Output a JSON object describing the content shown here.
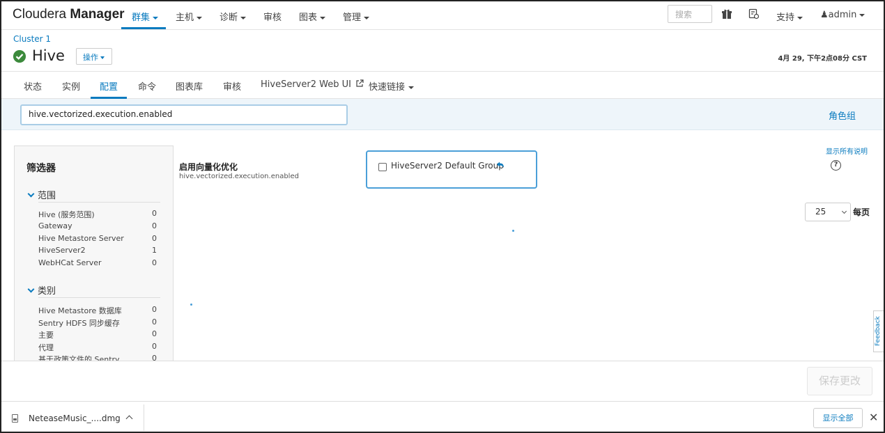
{
  "brand": {
    "name_light": "Cloudera",
    "name_bold": "Manager"
  },
  "topnav": {
    "items": [
      {
        "label": "群集",
        "active": true
      },
      {
        "label": "主机"
      },
      {
        "label": "诊断"
      },
      {
        "label": "审核"
      },
      {
        "label": "图表"
      },
      {
        "label": "管理"
      }
    ],
    "search_placeholder": "搜索",
    "support_label": "支持",
    "user_label": "admin"
  },
  "header": {
    "cluster": "Cluster 1",
    "service": "Hive",
    "actions_label": "操作",
    "timestamp": "4月 29, 下午2点08分 CST"
  },
  "tabs": [
    {
      "label": "状态"
    },
    {
      "label": "实例"
    },
    {
      "label": "配置",
      "active": true
    },
    {
      "label": "命令"
    },
    {
      "label": "图表库"
    },
    {
      "label": "审核"
    },
    {
      "label": "HiveServer2 Web UI"
    },
    {
      "label": "快速链接"
    }
  ],
  "config_search": {
    "value": "hive.vectorized.execution.enabled"
  },
  "role_groups_label": "角色组",
  "filters": {
    "title": "筛选器",
    "scope": {
      "label": "范围",
      "items": [
        {
          "name": "Hive (服务范围)",
          "count": "0"
        },
        {
          "name": "Gateway",
          "count": "0"
        },
        {
          "name": "Hive Metastore Server",
          "count": "0"
        },
        {
          "name": "HiveServer2",
          "count": "1"
        },
        {
          "name": "WebHCat Server",
          "count": "0"
        }
      ]
    },
    "category": {
      "label": "类别",
      "items": [
        {
          "name": "Hive Metastore 数据库",
          "count": "0"
        },
        {
          "name": "Sentry HDFS 同步缓存",
          "count": "0"
        },
        {
          "name": "主要",
          "count": "0"
        },
        {
          "name": "代理",
          "count": "0"
        },
        {
          "name": "基于政策文件的 Sentry",
          "count": "0"
        }
      ]
    }
  },
  "property": {
    "label": "启用向量化优化",
    "key": "hive.vectorized.execution.enabled",
    "group_label": "HiveServer2 Default Group",
    "checked": false
  },
  "show_all_descriptions": "显示所有说明",
  "page_size": {
    "value": "25",
    "suffix": "每页"
  },
  "feedback_label": "Feedback",
  "save_label": "保存更改",
  "download": {
    "file": "NeteaseMusic_....dmg",
    "show_all": "显示全部"
  },
  "colors": {
    "accent": "#0a7bbf",
    "ok": "#3c8a3c"
  }
}
